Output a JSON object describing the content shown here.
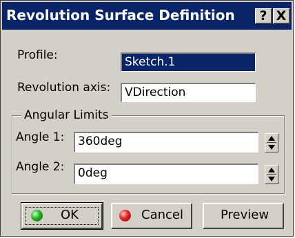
{
  "window": {
    "title": "Revolution Surface Definition",
    "help_label": "?",
    "close_label": "X"
  },
  "profile": {
    "label": "Profile:",
    "value": "Sketch.1"
  },
  "revolution_axis": {
    "label": "Revolution axis:",
    "value": "VDirection"
  },
  "angular_limits": {
    "title": "Angular Limits",
    "angle1": {
      "label": "Angle 1:",
      "value": "360deg"
    },
    "angle2": {
      "label": "Angle 2:",
      "value": "0deg"
    }
  },
  "buttons": {
    "ok_label": "OK",
    "cancel_label": "Cancel",
    "preview_label": "Preview"
  },
  "colors": {
    "titlebar": "#0a246a",
    "dialog_face": "#d4d0c8",
    "ok_icon": "#22b022",
    "cancel_icon": "#e02020"
  },
  "icons": {
    "ok": "green-orb-icon",
    "cancel": "red-orb-icon",
    "spin_up": "triangle-up-icon",
    "spin_down": "triangle-down-icon"
  }
}
